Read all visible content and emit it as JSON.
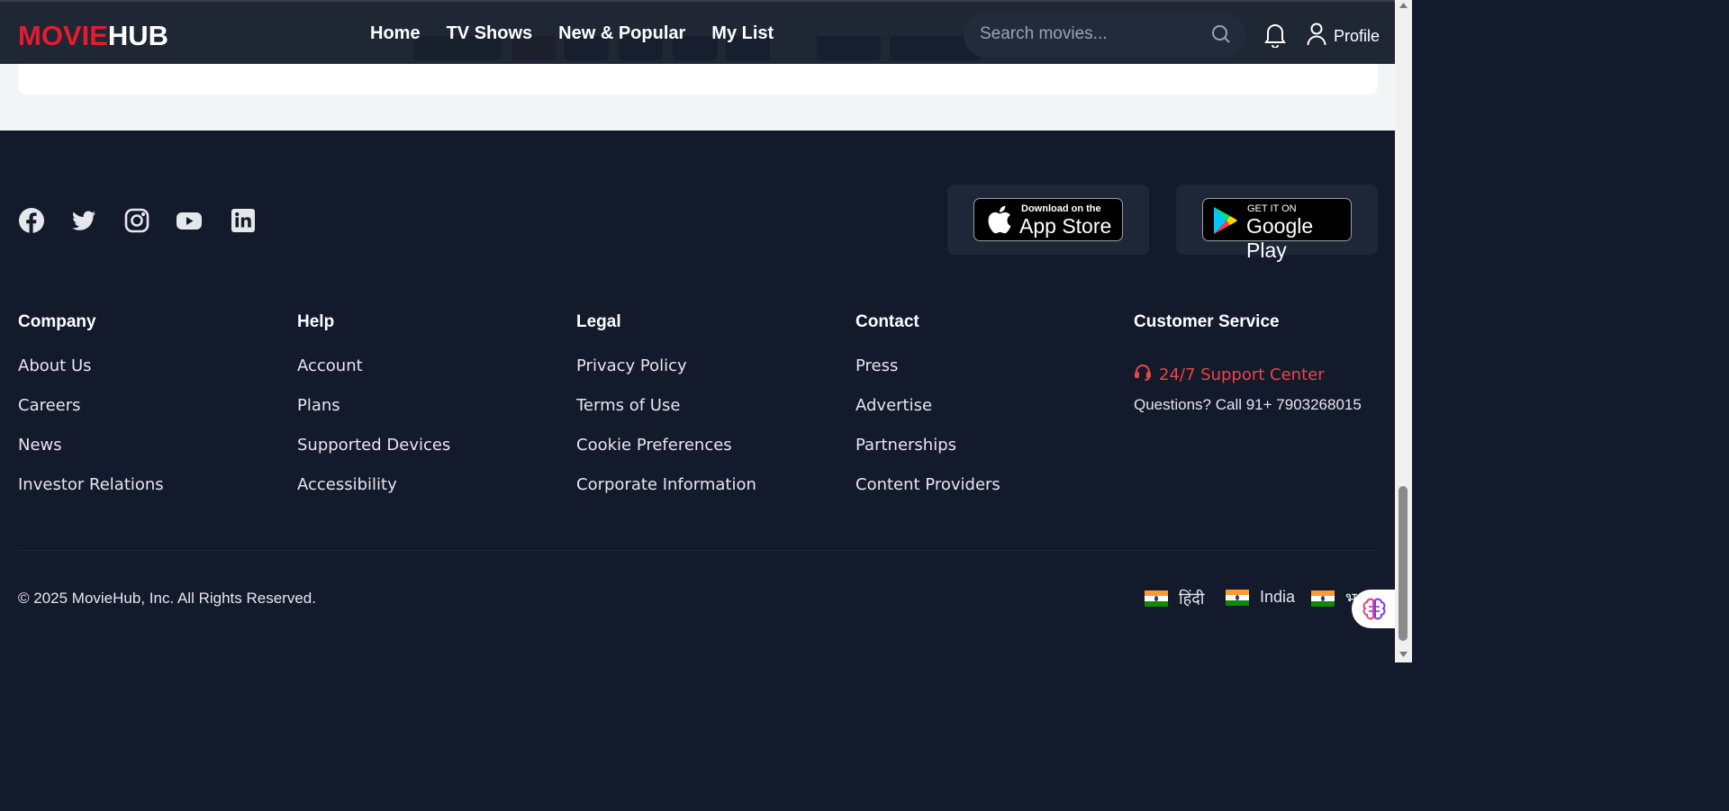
{
  "brand": {
    "part1": "MOVIE",
    "part2": "HUB",
    "accent_color": "#e11d2e"
  },
  "nav": {
    "links": [
      "Home",
      "TV Shows",
      "New & Popular",
      "My List"
    ],
    "search_placeholder": "Search movies...",
    "profile_label": "Profile"
  },
  "social_icons": [
    "facebook-icon",
    "twitter-icon",
    "instagram-icon",
    "youtube-icon",
    "linkedin-icon"
  ],
  "app_badges": {
    "apple": {
      "small": "Download on the",
      "big": "App Store"
    },
    "google": {
      "small": "GET IT ON",
      "big": "Google Play"
    }
  },
  "columns": [
    {
      "title": "Company",
      "links": [
        "About Us",
        "Careers",
        "News",
        "Investor Relations"
      ]
    },
    {
      "title": "Help",
      "links": [
        "Account",
        "Plans",
        "Supported Devices",
        "Accessibility"
      ]
    },
    {
      "title": "Legal",
      "links": [
        "Privacy Policy",
        "Terms of Use",
        "Cookie Preferences",
        "Corporate Information"
      ]
    },
    {
      "title": "Contact",
      "links": [
        "Press",
        "Advertise",
        "Partnerships",
        "Content Providers"
      ]
    }
  ],
  "customer_service": {
    "title": "Customer Service",
    "support_label": "24/7 Support Center",
    "questions": "Questions? Call 91+ 7903268015"
  },
  "footer_bottom": {
    "copyright": "© 2025 MovieHub, Inc. All Rights Reserved.",
    "languages": [
      "हिंदी",
      "India",
      "भ"
    ]
  },
  "colors": {
    "footer_bg": "#121a2b",
    "nav_bg": "#181f2d",
    "support_red": "#ef4444",
    "page_bg": "#f3f4f6"
  }
}
